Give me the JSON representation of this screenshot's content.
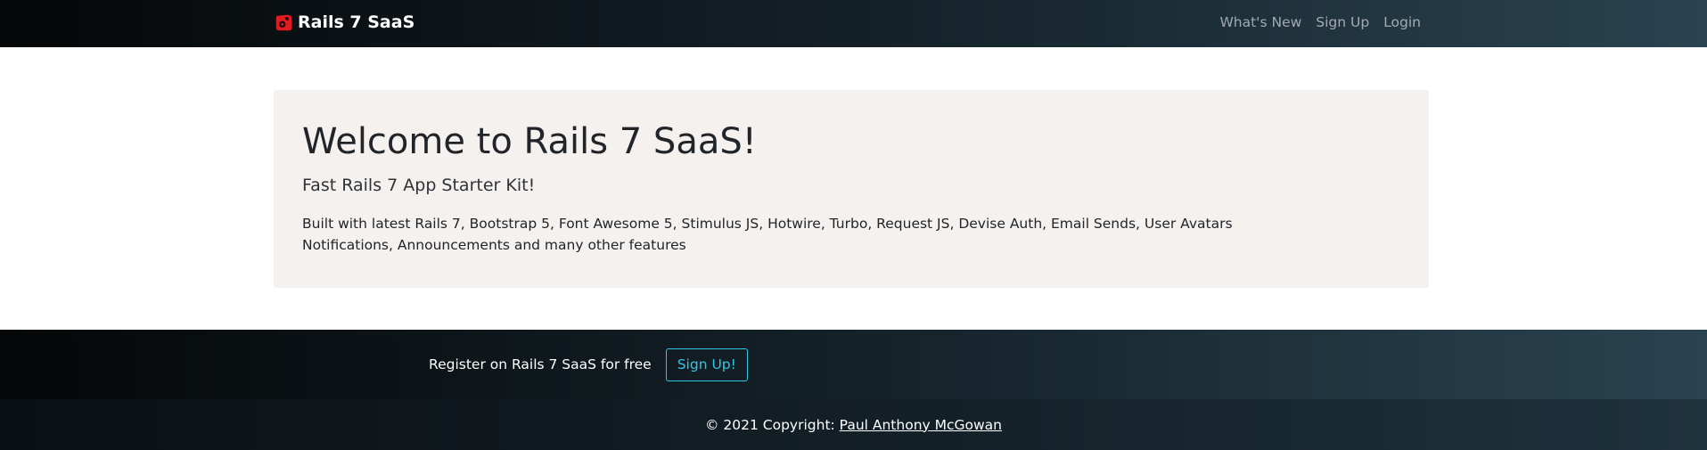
{
  "navbar": {
    "brand": "Rails 7 SaaS",
    "brand_icon": "rails-logo-icon",
    "links": [
      "What's New",
      "Sign Up",
      "Login"
    ]
  },
  "hero": {
    "title": "Welcome to Rails 7 SaaS!",
    "lead": "Fast Rails 7 App Starter Kit!",
    "description": "Built with latest Rails 7, Bootstrap 5, Font Awesome 5, Stimulus JS, Hotwire, Turbo, Request JS, Devise Auth, Email Sends, User Avatars Notifications, Announcements and many other features"
  },
  "footer": {
    "register_text": "Register on Rails 7 SaaS for free",
    "signup_button": "Sign Up!",
    "copyright_prefix": "© 2021 Copyright: ",
    "copyright_link": "Paul Anthony McGowan"
  },
  "colors": {
    "accent": "#2ec8e6",
    "brand_red": "#e21b23",
    "hero_bg": "#f5f1ef",
    "nav_dark": "#050708"
  }
}
